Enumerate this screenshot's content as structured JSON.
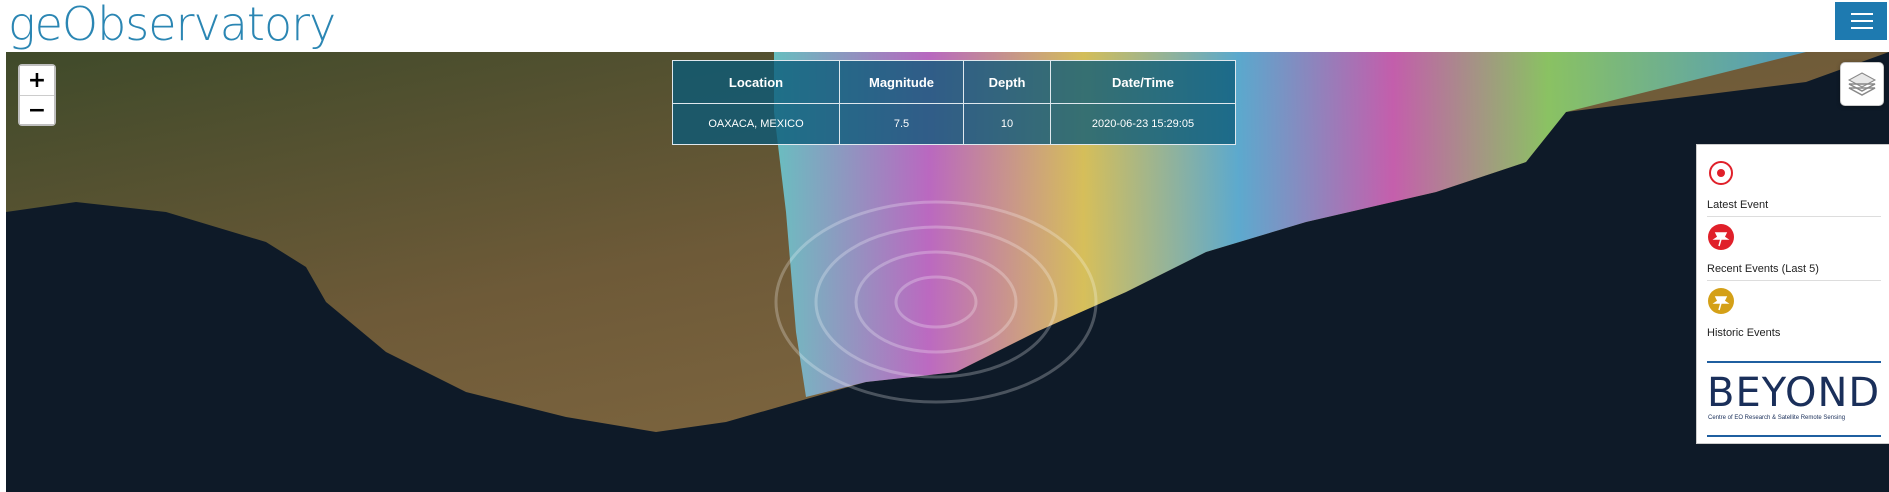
{
  "header": {
    "logo_text": "geObservatory",
    "menu_icon": "hamburger-icon"
  },
  "map": {
    "zoom_in_label": "+",
    "zoom_out_label": "−",
    "layers_icon": "layers-icon"
  },
  "event_table": {
    "headers": [
      "Location",
      "Magnitude",
      "Depth",
      "Date/Time"
    ],
    "rows": [
      [
        "OAXACA, MEXICO",
        "7.5",
        "10",
        "2020-06-23 15:29:05"
      ]
    ]
  },
  "legend": {
    "items": [
      {
        "label": "Latest Event",
        "icon": "target-icon",
        "color": "#e0202a"
      },
      {
        "label": "Recent Events (Last 5)",
        "icon": "red-pin-icon",
        "color": "#e0202a"
      },
      {
        "label": "Historic Events",
        "icon": "gold-pin-icon",
        "color": "#d4a017"
      }
    ],
    "logo": {
      "title": "BEYOND",
      "subtitle": "Centre of EO Research & Satellite Remote Sensing"
    }
  },
  "colors": {
    "brand": "#2b86b3",
    "menu_bg": "#1e7ab0",
    "table_bg": "#0a5a78",
    "sea": "#0e1a28",
    "land": "#6b5a3a"
  }
}
